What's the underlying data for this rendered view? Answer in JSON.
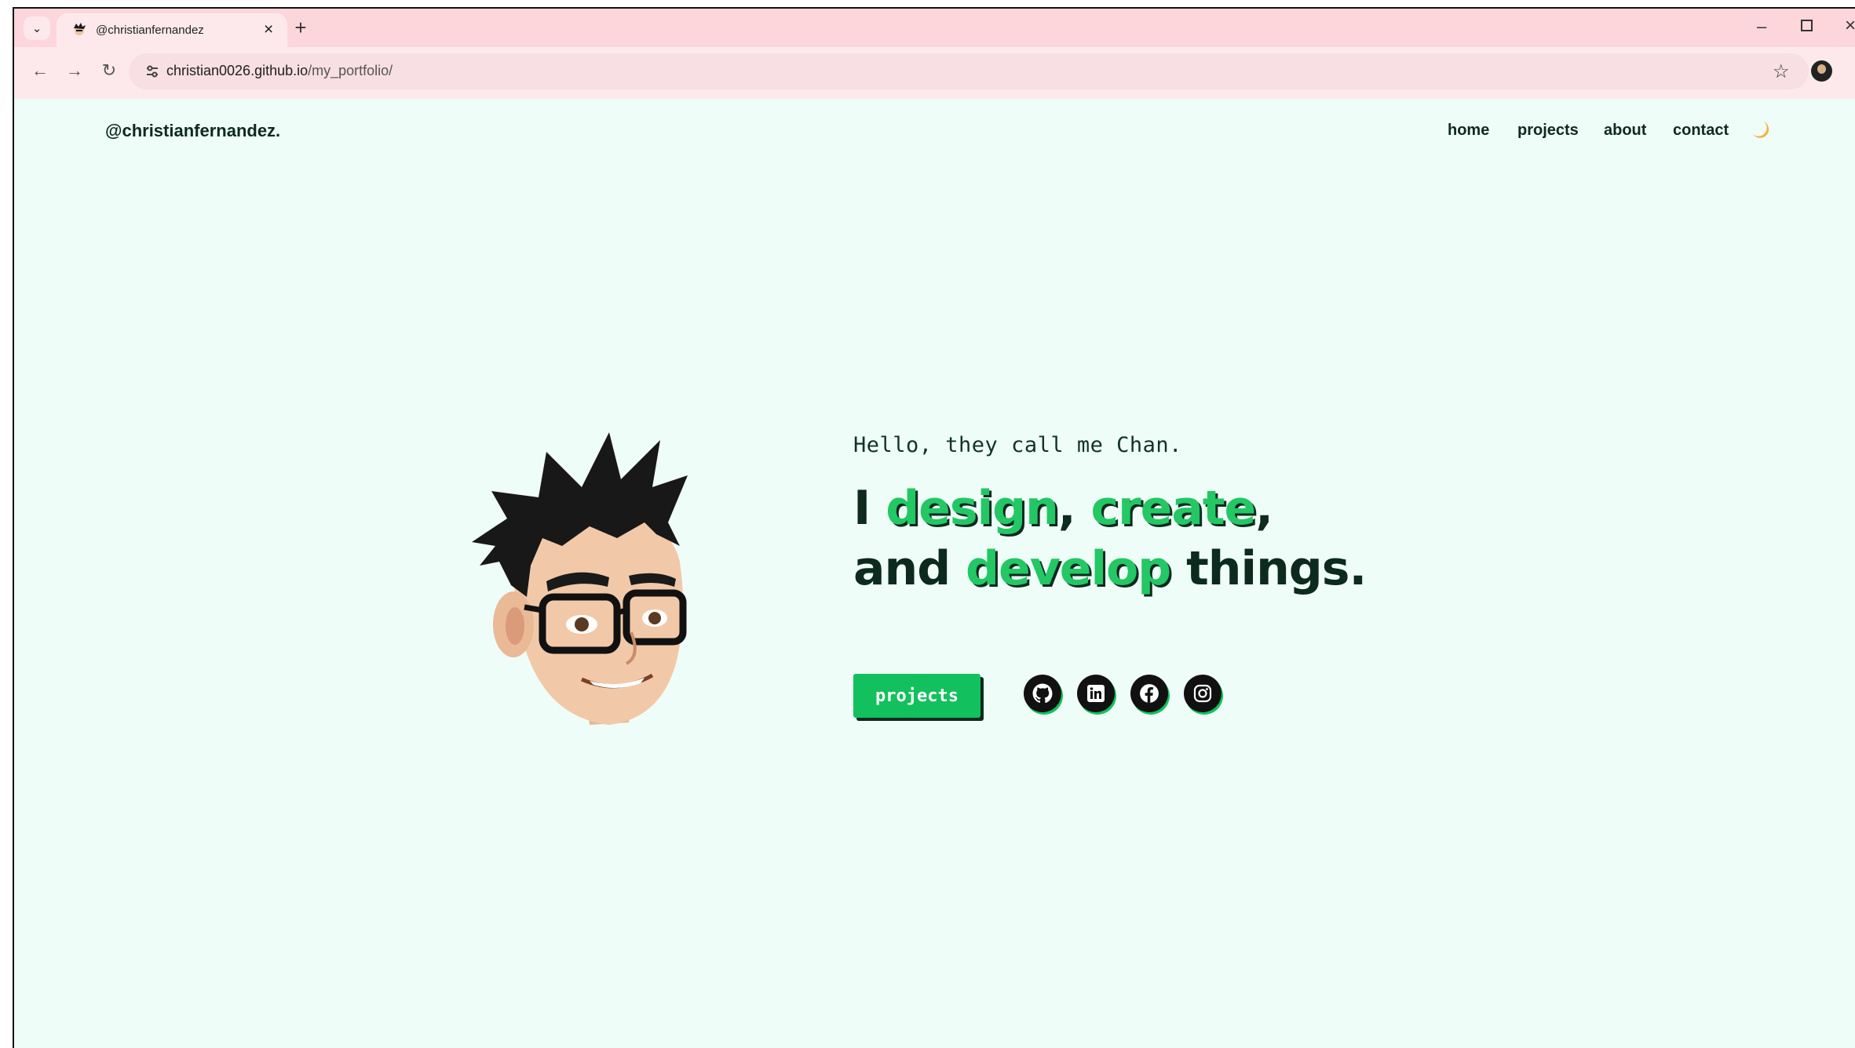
{
  "browser": {
    "tab_title": "@christianfernandez",
    "url_host": "christian0026.github.io",
    "url_path": "/my_portfolio/"
  },
  "site": {
    "logo": "@christianfernandez.",
    "nav": {
      "home": "home",
      "projects": "projects",
      "about": "about",
      "contact": "contact"
    },
    "theme_toggle_icon": "moon-icon"
  },
  "hero": {
    "greeting": "Hello, they call me Chan.",
    "line1_prefix": "I ",
    "line1_word1": "design",
    "line1_sep": ", ",
    "line1_word2": "create",
    "line1_suffix": ",",
    "line2_prefix": "and ",
    "line2_word": "develop",
    "line2_suffix": " things.",
    "cta_label": "projects",
    "social_icons": [
      "github-icon",
      "linkedin-icon",
      "facebook-icon",
      "instagram-icon"
    ]
  },
  "colors": {
    "accent": "#12c15d",
    "dark": "#0d2a1f",
    "page_bg": "#effdf8",
    "tabstrip": "#fdd6dc"
  }
}
